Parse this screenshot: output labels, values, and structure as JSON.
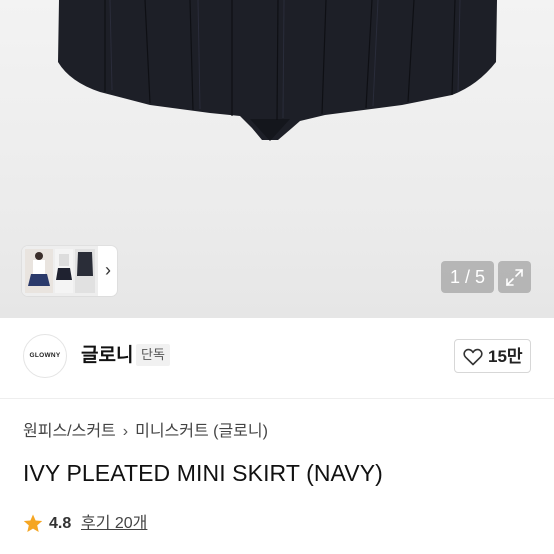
{
  "gallery": {
    "page_counter": "1 / 5",
    "thumbnail_nav_icon": "chevron-right-icon",
    "expand_icon": "expand-arrows-icon"
  },
  "brand": {
    "logo_text": "GLOWNY",
    "name": "글로니",
    "badge": "단독",
    "like_icon": "heart-outline-icon",
    "like_count": "15만"
  },
  "breadcrumb": {
    "items": [
      "원피스/스커트",
      "미니스커트 (글로니)"
    ],
    "separator": "›"
  },
  "product": {
    "title": "IVY PLEATED MINI SKIRT (NAVY)",
    "rating": "4.8",
    "rating_icon": "star-icon",
    "review_link": "후기 20개"
  },
  "colors": {
    "skirt_navy": "#1d1f27",
    "star": "#f5a623",
    "counter_bg": "#8a8a8a"
  }
}
